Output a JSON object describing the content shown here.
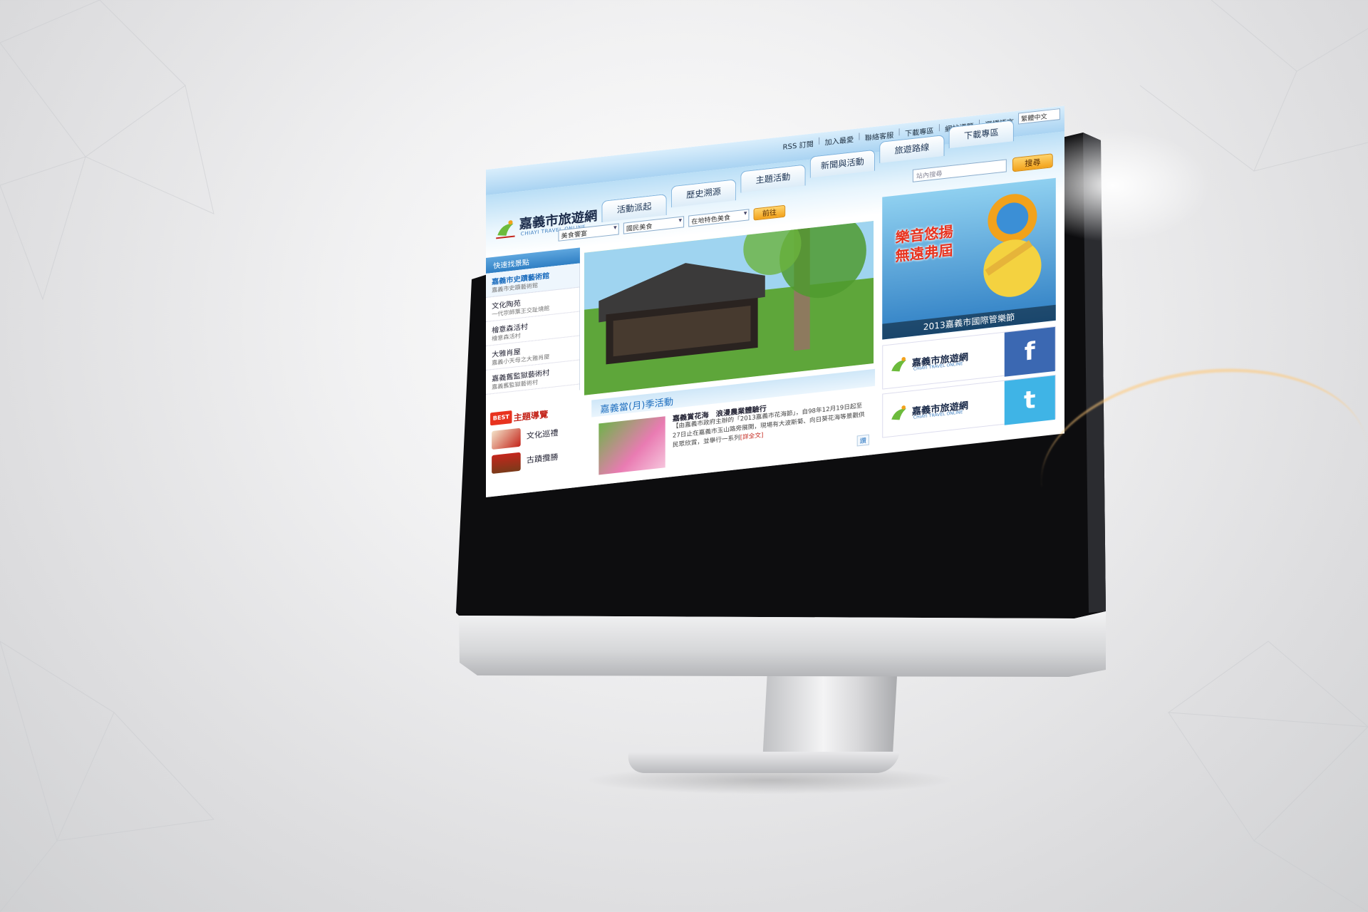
{
  "site": {
    "name": "嘉義市旅遊網",
    "name_en": "CHIAYI TRAVEL ONLINE"
  },
  "top_links": [
    "RSS 訂閱",
    "加入最愛",
    "聯絡客服",
    "下載專區",
    "網站導覽",
    "選擇語言"
  ],
  "language_select": "繁體中文",
  "nav_tabs": [
    "活動派起",
    "歷史溯源",
    "主題活動",
    "新聞與活動",
    "旅遊路線",
    "下載專區"
  ],
  "search": {
    "placeholder": "站內搜尋",
    "button": "搜尋"
  },
  "filters": {
    "select_1": "美食饗宴",
    "select_2": "國民美食",
    "select_3": "在地特色美食",
    "go_button": "前往"
  },
  "quick_bar": "快速找景點",
  "attractions": [
    {
      "title": "嘉義市史蹟藝術館",
      "sub": "嘉義市史蹟藝術館"
    },
    {
      "title": "文化陶苑",
      "sub": "一代宗師葉王交趾燒館"
    },
    {
      "title": "檜意森活村",
      "sub": "檜意森活村"
    },
    {
      "title": "大雅肖屋",
      "sub": "嘉義小天母之大雅肖屋"
    },
    {
      "title": "嘉義舊監獄藝術村",
      "sub": "嘉義舊監獄藝術村"
    }
  ],
  "side_ad": {
    "headline_1": "樂音悠揚",
    "headline_2": "無遠弗屆",
    "caption": "2013嘉義市國際管樂節"
  },
  "social": {
    "facebook_badge": "f",
    "twitter_badge": "t"
  },
  "best": {
    "badge": "BEST",
    "title": "主題導覽",
    "items": [
      "文化巡禮",
      "古蹟攬勝"
    ]
  },
  "event": {
    "header": "嘉義當(月)季活動",
    "title": "嘉義賞花海　浪漫農業體驗行",
    "body": "【由嘉義市政府主辦的「2013嘉義市花海節」，自98年12月19日起至27日止在嘉義市玉山路旁展開，現場有大波斯菊、向日葵花海等景觀供民眾欣賞，並舉行一系列",
    "more": "[詳全文]",
    "like": "讚"
  },
  "colors": {
    "nav_blue": "#2f7fc4",
    "accent_orange": "#f2a21b",
    "accent_red": "#e8331f",
    "facebook": "#3b68b2",
    "twitter": "#3fb4e6"
  }
}
